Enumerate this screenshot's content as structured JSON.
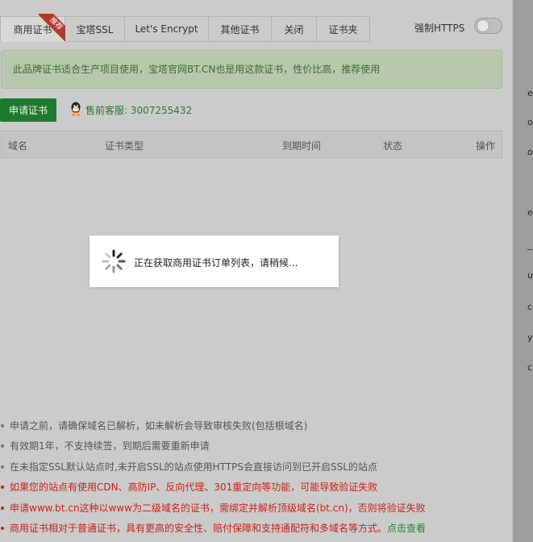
{
  "tabs": [
    {
      "label": "商用证书",
      "active": true,
      "badge": "推荐"
    },
    {
      "label": "宝塔SSL"
    },
    {
      "label": "Let's Encrypt"
    },
    {
      "label": "其他证书"
    },
    {
      "label": "关闭"
    },
    {
      "label": "证书夹"
    }
  ],
  "force_https": {
    "label": "强制HTTPS",
    "enabled": false
  },
  "notice": "此品牌证书适合生产项目使用，宝塔官网BT.CN也是用这款证书，性价比高，推荐使用",
  "apply_button": "申请证书",
  "service": {
    "icon": "qq-penguin-icon",
    "text": "售前客服: 3007255432"
  },
  "table": {
    "columns": [
      "域名",
      "证书类型",
      "到期时间",
      "状态",
      "操作"
    ]
  },
  "loading": {
    "text": "正在获取商用证书订单列表，请稍候..."
  },
  "tips": [
    {
      "text": "申请之前，请确保域名已解析，如未解析会导致审核失败(包括根域名)",
      "style": "gray"
    },
    {
      "text": "有效期1年，不支持续签，到期后需要重新申请",
      "style": "gray"
    },
    {
      "text": "在未指定SSL默认站点时,未开启SSL的站点使用HTTPS会直接访问到已开启SSL的站点",
      "style": "gray"
    },
    {
      "text": "如果您的站点有使用CDN、高防IP、反向代理、301重定向等功能，可能导致验证失败",
      "style": "red"
    },
    {
      "text": "申请www.bt.cn这种以www为二级域名的证书，需绑定并解析顶级域名(bt.cn)，否则将验证失败",
      "style": "red"
    },
    {
      "text": "商用证书相对于普通证书，具有更高的安全性、赔付保障和支持通配符和多域名等方式。",
      "style": "red",
      "link": "点击查看"
    }
  ],
  "right_strip_letters": [
    "e",
    "o",
    "o",
    "e",
    "_",
    "u",
    "c",
    "y",
    "c"
  ],
  "colors": {
    "accent_green": "#20a53a",
    "warning_red": "#e02a1e",
    "notice_bg": "#dff0d8"
  }
}
